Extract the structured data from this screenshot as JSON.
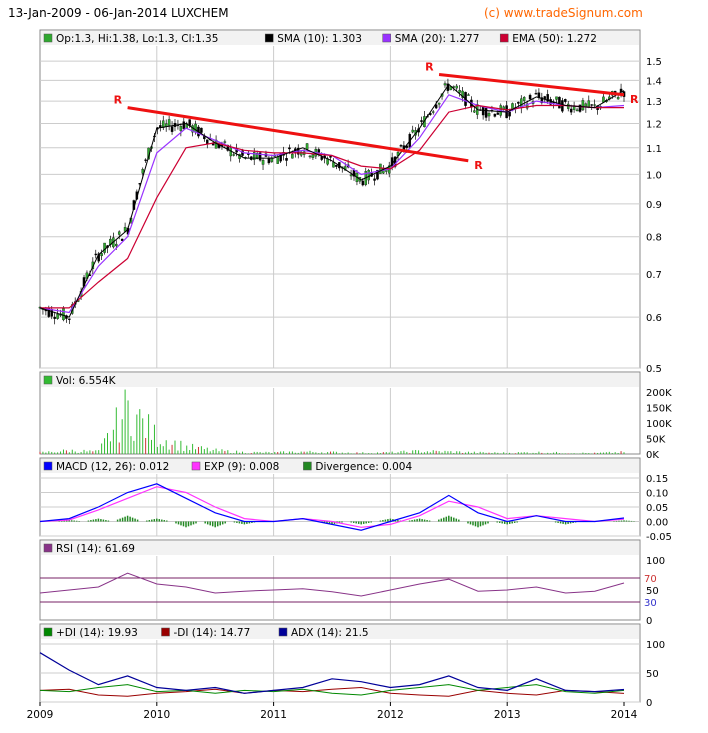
{
  "header": {
    "title": "13-Jan-2009 - 06-Jan-2014 LUXCHEM",
    "credit": "(c) www.tradeSignum.com"
  },
  "colors": {
    "price_up": "#2fa82f",
    "price_down": "#000000",
    "sma10": "#000000",
    "sma20": "#9933ff",
    "ema50": "#cc0033",
    "trendline": "#ee1111",
    "volume": "#33bb33",
    "macd": "#0000ff",
    "signal": "#ff33ff",
    "divergence": "#228822",
    "rsi": "#883388",
    "rsi_levels": "#772266",
    "plus_di": "#008800",
    "minus_di": "#990000",
    "adx": "#000099",
    "grid": "#cccccc",
    "frame": "#888888"
  },
  "x_labels": [
    "2009",
    "2010",
    "2011",
    "2012",
    "2013",
    "2014"
  ],
  "panels": {
    "price": {
      "legend": [
        {
          "text": "Op:1.3, Hi:1.38, Lo:1.3, Cl:1.35",
          "color": "#2fa82f"
        },
        {
          "text": "SMA (10): 1.303",
          "color": "#000000"
        },
        {
          "text": "SMA (20): 1.277",
          "color": "#9933ff"
        },
        {
          "text": "EMA (50): 1.272",
          "color": "#cc0033"
        }
      ],
      "y_ticks": [
        "1.5",
        "1.4",
        "1.3",
        "1.2",
        "1.1",
        "1.0",
        "0.9",
        "0.8",
        "0.7",
        "0.6",
        "0.5"
      ],
      "trendlines": [
        {
          "start": [
            "2009-10",
            1.27
          ],
          "end": [
            "2012-09",
            1.05
          ],
          "label_start": "R",
          "label_end": "R"
        },
        {
          "start": [
            "2012-06",
            1.43
          ],
          "end": [
            "2014-01",
            1.33
          ],
          "label_start": "R",
          "label_end": "R"
        }
      ]
    },
    "volume": {
      "legend": [
        {
          "text": "Vol: 6.554K",
          "color": "#33bb33"
        }
      ],
      "y_ticks": [
        "200K",
        "150K",
        "100K",
        "50K",
        "0K"
      ]
    },
    "macd": {
      "legend": [
        {
          "text": "MACD (12, 26): 0.012",
          "color": "#0000ff"
        },
        {
          "text": "EXP (9): 0.008",
          "color": "#ff33ff"
        },
        {
          "text": "Divergence: 0.004",
          "color": "#228822"
        }
      ],
      "y_ticks": [
        "0.15",
        "0.10",
        "0.05",
        "0.00",
        "-0.05"
      ]
    },
    "rsi": {
      "legend": [
        {
          "text": "RSI (14): 61.69",
          "color": "#883388"
        }
      ],
      "y_ticks": [
        "100",
        "50",
        "0"
      ],
      "level_labels": [
        "70",
        "30"
      ]
    },
    "dmi": {
      "legend": [
        {
          "text": "+DI (14): 19.93",
          "color": "#008800"
        },
        {
          "text": "-DI (14): 14.77",
          "color": "#990000"
        },
        {
          "text": "ADX (14): 21.5",
          "color": "#000099"
        }
      ],
      "y_ticks": [
        "100",
        "50",
        "0"
      ]
    }
  },
  "chart_data": {
    "type": "line",
    "title": "13-Jan-2009 - 06-Jan-2014 LUXCHEM",
    "x": [
      "2009-01",
      "2009-04",
      "2009-07",
      "2009-10",
      "2010-01",
      "2010-04",
      "2010-07",
      "2010-10",
      "2011-01",
      "2011-04",
      "2011-07",
      "2011-10",
      "2012-01",
      "2012-04",
      "2012-07",
      "2012-10",
      "2013-01",
      "2013-04",
      "2013-07",
      "2013-10",
      "2014-01"
    ],
    "series": [
      {
        "name": "Close",
        "values": [
          0.62,
          0.6,
          0.75,
          0.82,
          1.18,
          1.2,
          1.12,
          1.06,
          1.06,
          1.1,
          1.05,
          0.98,
          1.03,
          1.18,
          1.38,
          1.26,
          1.25,
          1.32,
          1.28,
          1.27,
          1.35
        ]
      },
      {
        "name": "SMA (20)",
        "values": [
          0.62,
          0.61,
          0.72,
          0.8,
          1.08,
          1.18,
          1.13,
          1.08,
          1.07,
          1.09,
          1.07,
          1.0,
          1.02,
          1.14,
          1.33,
          1.28,
          1.25,
          1.3,
          1.28,
          1.27,
          1.28
        ]
      },
      {
        "name": "EMA (50)",
        "values": [
          0.62,
          0.62,
          0.68,
          0.74,
          0.92,
          1.1,
          1.12,
          1.09,
          1.08,
          1.08,
          1.07,
          1.03,
          1.02,
          1.09,
          1.25,
          1.28,
          1.26,
          1.28,
          1.28,
          1.27,
          1.27
        ]
      }
    ],
    "xlabel": "",
    "ylabel": "",
    "ylim": [
      0.5,
      1.55
    ],
    "y_scale": "log",
    "volume": {
      "values": [
        5,
        12,
        8,
        160,
        60,
        25,
        12,
        6,
        5,
        8,
        6,
        4,
        5,
        10,
        8,
        5,
        4,
        6,
        4,
        3,
        6.554
      ],
      "ylim": [
        0,
        200
      ]
    },
    "macd": {
      "macd": [
        0.0,
        0.01,
        0.05,
        0.1,
        0.13,
        0.08,
        0.03,
        0.0,
        0.0,
        0.01,
        -0.01,
        -0.03,
        0.0,
        0.03,
        0.09,
        0.03,
        0.0,
        0.02,
        0.0,
        0.0,
        0.012
      ],
      "signal": [
        0.0,
        0.005,
        0.04,
        0.08,
        0.12,
        0.1,
        0.05,
        0.01,
        0.0,
        0.01,
        0.0,
        -0.02,
        -0.01,
        0.02,
        0.07,
        0.05,
        0.01,
        0.02,
        0.01,
        0.0,
        0.008
      ],
      "ylim": [
        -0.05,
        0.15
      ]
    },
    "rsi": {
      "values": [
        45,
        50,
        55,
        78,
        60,
        55,
        45,
        48,
        50,
        52,
        47,
        40,
        50,
        60,
        68,
        48,
        50,
        55,
        45,
        48,
        61.69
      ],
      "levels": [
        70,
        30
      ],
      "ylim": [
        0,
        100
      ]
    },
    "dmi": {
      "plus_di": [
        20,
        18,
        25,
        30,
        18,
        20,
        15,
        20,
        18,
        22,
        15,
        12,
        20,
        25,
        30,
        20,
        25,
        30,
        18,
        15,
        19.93
      ],
      "minus_di": [
        20,
        22,
        12,
        10,
        15,
        18,
        22,
        15,
        20,
        18,
        22,
        25,
        15,
        12,
        10,
        20,
        15,
        12,
        20,
        18,
        14.77
      ],
      "adx": [
        85,
        55,
        30,
        45,
        25,
        20,
        25,
        15,
        20,
        25,
        40,
        35,
        25,
        30,
        45,
        25,
        20,
        40,
        20,
        18,
        21.5
      ],
      "ylim": [
        0,
        100
      ]
    }
  }
}
